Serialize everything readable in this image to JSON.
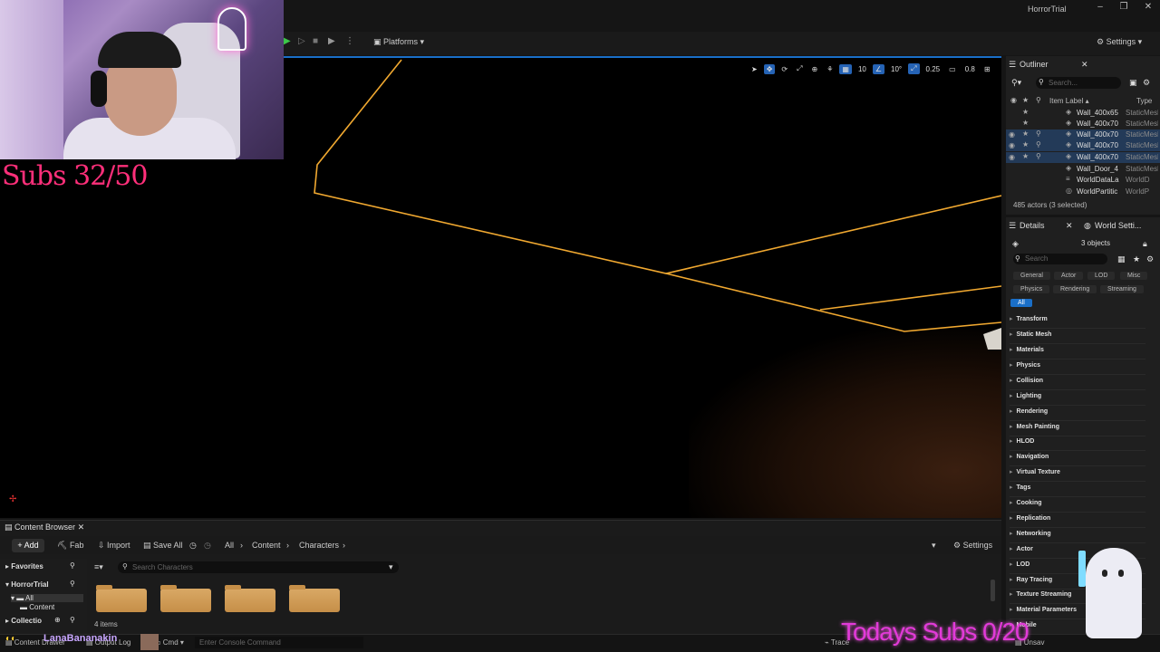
{
  "window": {
    "title": "HorrorTrial",
    "minimize": "–",
    "maximize": "❐",
    "close": "✕"
  },
  "toolbar": {
    "platforms_label": "Platforms",
    "settings_label": "Settings"
  },
  "viewport": {
    "grid_snap": "10",
    "rotation_snap": "10°",
    "scale_snap": "0.25",
    "camera_speed": "0.8"
  },
  "stream_overlay": {
    "subs_goal": "Subs 32/50",
    "todays_subs": "Todays Subs 0/20",
    "twitch_name": "LanaBananakin"
  },
  "outliner": {
    "tab": "Outliner",
    "search_placeholder": "Search...",
    "col_label": "Item Label ▴",
    "col_type": "Type",
    "rows": [
      {
        "label": "Wall_400x65",
        "type": "StaticMesh",
        "selected": false
      },
      {
        "label": "Wall_400x70",
        "type": "StaticMesh",
        "selected": false
      },
      {
        "label": "Wall_400x70",
        "type": "StaticMesh",
        "selected": true
      },
      {
        "label": "Wall_400x70",
        "type": "StaticMesh",
        "selected": true
      },
      {
        "label": "Wall_400x70",
        "type": "StaticMesh",
        "selected": true
      },
      {
        "label": "Wall_Door_4",
        "type": "StaticMesh",
        "selected": false
      },
      {
        "label": "WorldDataLa",
        "type": "WorldD",
        "selected": false
      },
      {
        "label": "WorldPartitic",
        "type": "WorldP",
        "selected": false
      }
    ],
    "footer": "485 actors (3 selected)"
  },
  "details": {
    "tab": "Details",
    "tab2": "World Setti...",
    "objects": "3 objects",
    "search_placeholder": "Search",
    "filters_row1": [
      "General",
      "Actor",
      "LOD",
      "Misc"
    ],
    "filters_row2": [
      "Physics",
      "Rendering",
      "Streaming"
    ],
    "filter_all": "All",
    "categories": [
      "Transform",
      "Static Mesh",
      "Materials",
      "Physics",
      "Collision",
      "Lighting",
      "Rendering",
      "Mesh Painting",
      "HLOD",
      "Navigation",
      "Virtual Texture",
      "Tags",
      "Cooking",
      "Replication",
      "Networking",
      "Actor",
      "LOD",
      "Ray Tracing",
      "Texture Streaming",
      "Material Parameters",
      "Mobile"
    ]
  },
  "content_browser": {
    "tab": "Content Browser",
    "add": "+ Add",
    "fab": "Fab",
    "import": "Import",
    "save_all": "Save All",
    "breadcrumb": [
      "All",
      "Content",
      "Characters"
    ],
    "settings": "Settings",
    "favorites": "Favorites",
    "project": "HorrorTrial",
    "tree_all": "All",
    "tree_content": "Content",
    "collections": "Collectio",
    "search_placeholder": "Search Characters",
    "items_count": "4 items"
  },
  "statusbar": {
    "content_drawer": "Content Drawer",
    "output_log": "Output Log",
    "cmd": "Cmd",
    "console_placeholder": "Enter Console Command",
    "trace": "Trace",
    "unsaved": "Unsav"
  }
}
